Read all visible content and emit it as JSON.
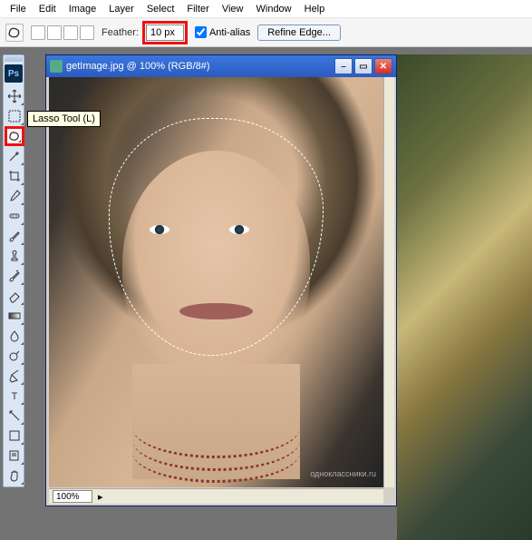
{
  "menu": [
    "File",
    "Edit",
    "Image",
    "Layer",
    "Select",
    "Filter",
    "View",
    "Window",
    "Help"
  ],
  "options": {
    "feather_label": "Feather:",
    "feather_value": "10 px",
    "antialias_label": "Anti-alias",
    "refine_label": "Refine Edge..."
  },
  "tooltip": "Lasso Tool (L)",
  "tools": [
    {
      "name": "move-tool",
      "icon": "move"
    },
    {
      "name": "marquee-tool",
      "icon": "marquee"
    },
    {
      "name": "lasso-tool",
      "icon": "lasso",
      "selected": true
    },
    {
      "name": "magic-wand-tool",
      "icon": "wand"
    },
    {
      "name": "crop-tool",
      "icon": "crop"
    },
    {
      "name": "eyedropper-tool",
      "icon": "eyedrop"
    },
    {
      "name": "healing-brush-tool",
      "icon": "heal"
    },
    {
      "name": "brush-tool",
      "icon": "brush"
    },
    {
      "name": "clone-stamp-tool",
      "icon": "stamp"
    },
    {
      "name": "history-brush-tool",
      "icon": "hbrush"
    },
    {
      "name": "eraser-tool",
      "icon": "eraser"
    },
    {
      "name": "gradient-tool",
      "icon": "grad"
    },
    {
      "name": "blur-tool",
      "icon": "blur"
    },
    {
      "name": "dodge-tool",
      "icon": "dodge"
    },
    {
      "name": "pen-tool",
      "icon": "pen"
    },
    {
      "name": "type-tool",
      "icon": "type"
    },
    {
      "name": "path-select-tool",
      "icon": "path"
    },
    {
      "name": "shape-tool",
      "icon": "shape"
    },
    {
      "name": "notes-tool",
      "icon": "note"
    },
    {
      "name": "hand-tool",
      "icon": "hand"
    }
  ],
  "doc": {
    "title": "getImage.jpg @ 100% (RGB/8#)",
    "zoom": "100%",
    "watermark": "одноклассники.ru"
  },
  "logo": "Ps"
}
